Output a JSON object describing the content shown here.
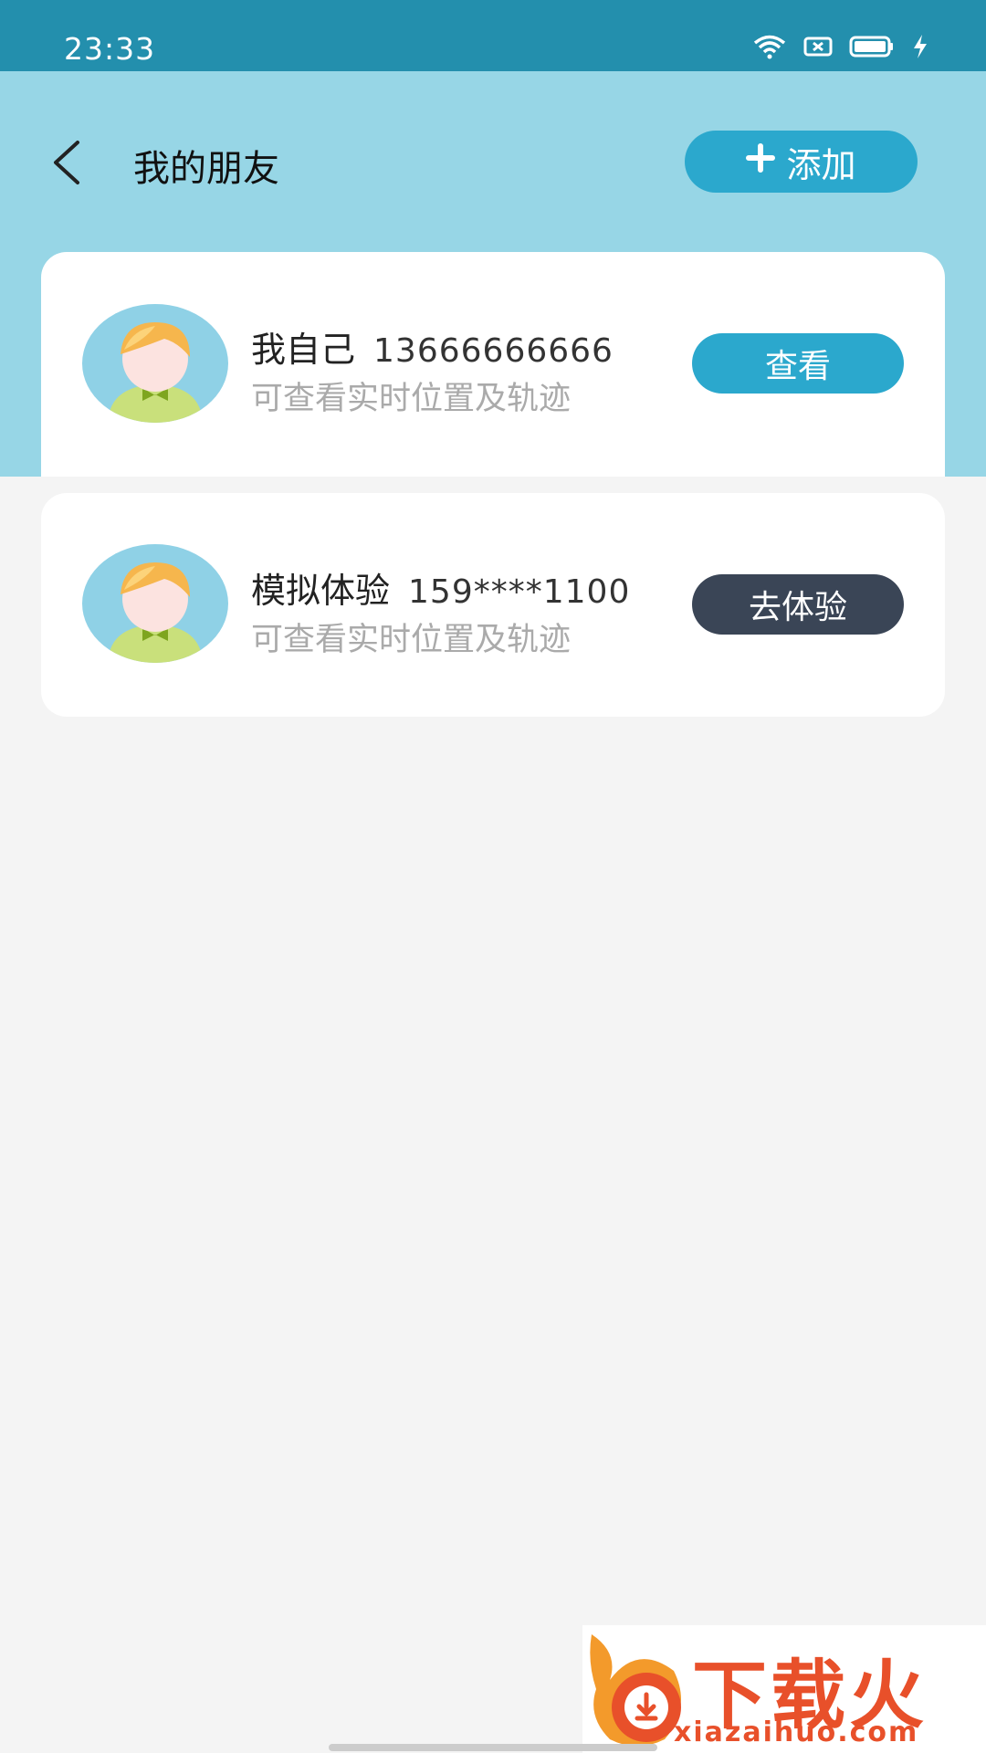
{
  "status_bar": {
    "time": "23:33",
    "icons": [
      "wifi-icon",
      "screen-record-icon",
      "battery-icon",
      "charging-icon"
    ]
  },
  "header": {
    "back_icon": "chevron-left-icon",
    "title": "我的朋友",
    "add_button_label": "添加",
    "add_icon": "plus-icon"
  },
  "friends": [
    {
      "name": "我自己",
      "phone": "13666666666",
      "description": "可查看实时位置及轨迹",
      "action_label": "查看"
    },
    {
      "name": "模拟体验",
      "phone": "159****1100",
      "description": "可查看实时位置及轨迹",
      "action_label": "去体验"
    }
  ],
  "watermark": {
    "text": "下载火",
    "url": "xiazaihuo.com"
  },
  "colors": {
    "status_bar": "#238fad",
    "header_bg": "#97d6e6",
    "primary_button": "#2ba8cd",
    "dark_button": "#3a4556",
    "page_bg": "#f4f4f4"
  }
}
